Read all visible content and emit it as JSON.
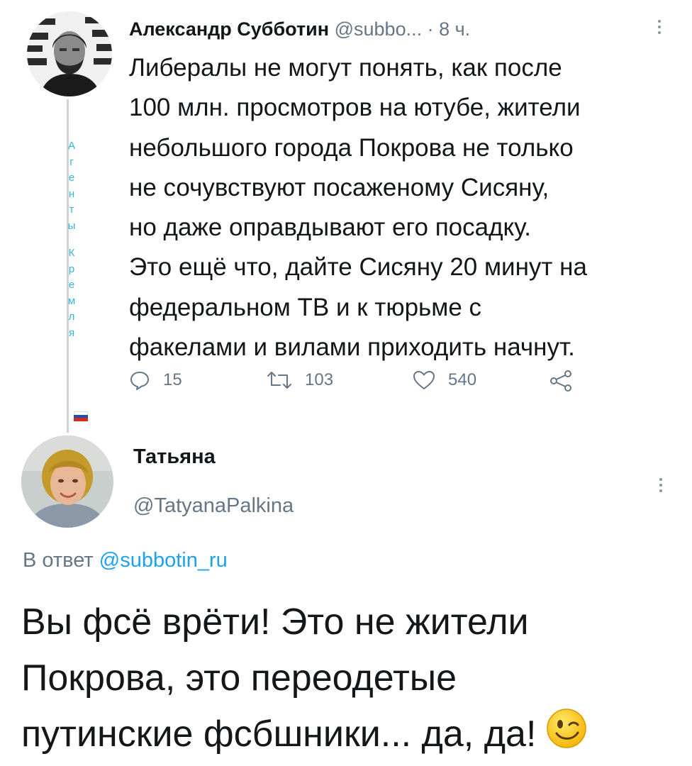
{
  "tweet": {
    "author_name": "Александр Субботин",
    "author_handle": "@subbo...",
    "time": " · 8 ч.",
    "more_icon": "⋮",
    "bio_vertical": [
      "А",
      "г",
      "е",
      "н",
      "т",
      "ы",
      "",
      "К",
      "р",
      "е",
      "м",
      "л",
      "я"
    ],
    "text_lines": [
      "Либералы не могут понять, как после",
      "100 млн. просмотров на ютубе, жители",
      "небольшого города Покрова не только",
      "не сочувствуют посаженому Сисяну,",
      "но даже оправдывают его посадку.",
      "Это ещё что, дайте Сисяну 20 минут на",
      "федеральном ТВ и к тюрьме с",
      "факелами и вилами приходить начнут."
    ],
    "actions": {
      "replies": "15",
      "retweets": "103",
      "likes": "540"
    },
    "icons": [
      "reply-icon",
      "retweet-icon",
      "like-icon",
      "share-icon",
      "flag-ru-icon"
    ]
  },
  "reply": {
    "author_name": "Татьяна",
    "author_handle": "@TatyanaPalkina",
    "more_icon": "⋮",
    "in_reply_to_prefix": "В ответ ",
    "in_reply_to_mention": "@subbotin_ru",
    "text_lines": [
      "Вы фсё врёти! Это не жители",
      "Покрова, это переодетые",
      "путинские фсбшники... да, да!"
    ],
    "emoji": "wink-emoji"
  },
  "colors": {
    "text": "#14171a",
    "secondary": "#657786",
    "link": "#1da1f2",
    "bio_accent": "#35b3d9"
  }
}
